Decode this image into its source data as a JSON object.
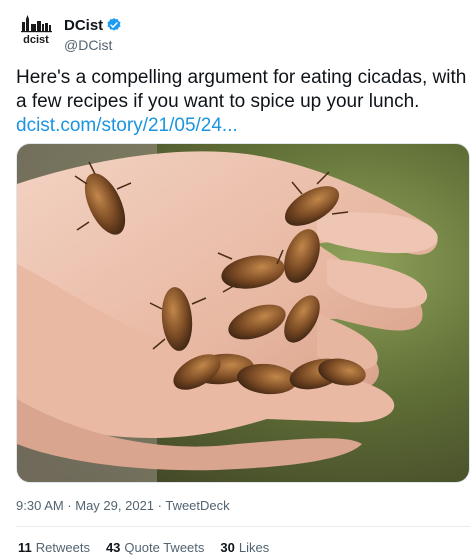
{
  "account": {
    "display_name": "DCist",
    "handle": "@DCist",
    "logo_text": "dcist",
    "verified": true,
    "avatar_icon": "dcist-logo-icon"
  },
  "tweet": {
    "text": "Here's a compelling argument for eating cicadas, with a few recipes if you want to spice up your lunch.",
    "link_text": "dcist.com/story/21/05/24..."
  },
  "media": {
    "description_icon": "photo-hands-holding-cicadas"
  },
  "meta": {
    "timestamp": "9:30 AM · May 29, 2021 · TweetDeck"
  },
  "stats": {
    "retweets_count": "11",
    "retweets_label": "Retweets",
    "quotes_count": "43",
    "quotes_label": "Quote Tweets",
    "likes_count": "30",
    "likes_label": "Likes"
  },
  "colors": {
    "link": "#1b95e0",
    "verified": "#1d9bf0",
    "secondary_text": "#536471"
  }
}
